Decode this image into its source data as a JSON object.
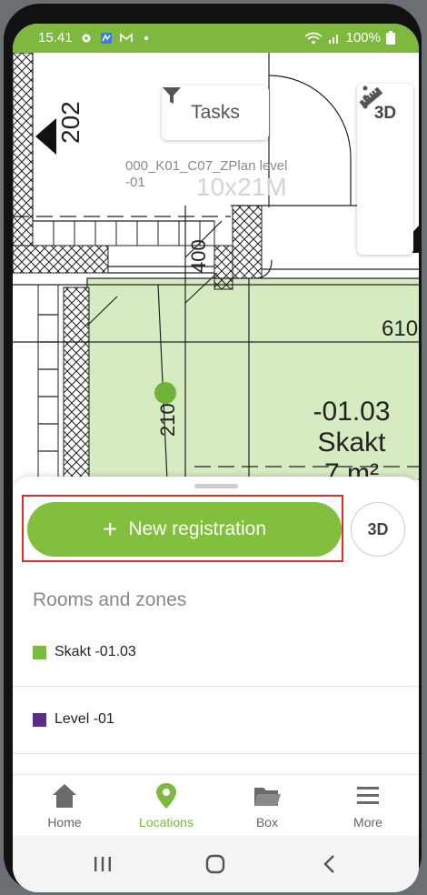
{
  "status": {
    "time": "15.41",
    "battery": "100%"
  },
  "map": {
    "tasks_label": "Tasks",
    "tool_3d": "3D",
    "plan_level": "000_K01_C07_ZPlan level -01",
    "plan_size": "10x21M",
    "room": {
      "number": "-01.03",
      "name": "Skakt",
      "area": "7 m²"
    },
    "dims": {
      "d202": "202",
      "d400": "400",
      "d610": "610",
      "d210": "210"
    }
  },
  "sheet": {
    "new_registration": "New registration",
    "btn_3d": "3D",
    "section_title": "Rooms and zones",
    "zones": [
      {
        "label": "Skakt -01.03",
        "color": "#7eb83e"
      },
      {
        "label": "Level -01",
        "color": "#5b2d86"
      }
    ]
  },
  "nav": [
    {
      "label": "Home",
      "icon": "home-icon"
    },
    {
      "label": "Locations",
      "icon": "location-pin-icon"
    },
    {
      "label": "Box",
      "icon": "folder-icon"
    },
    {
      "label": "More",
      "icon": "menu-icon"
    }
  ],
  "colors": {
    "accent": "#7eb83e",
    "highlight": "#d9302c",
    "level_swatch": "#5b2d86"
  }
}
